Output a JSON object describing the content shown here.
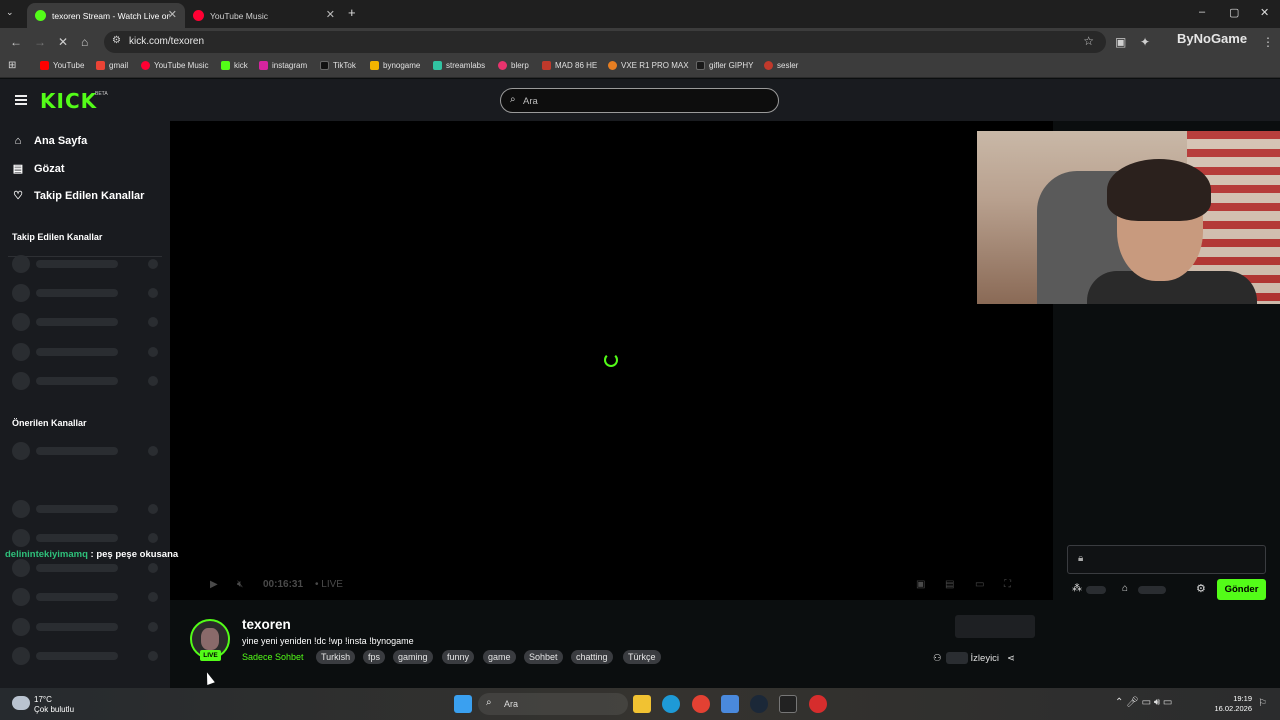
{
  "browser": {
    "tabs": [
      {
        "label": "texoren Stream - Watch Live on Kick",
        "active": true,
        "favicon_color": "#53fc18"
      },
      {
        "label": "YouTube Music",
        "active": false,
        "favicon_color": "#ff0033"
      }
    ],
    "new_tab": "+",
    "window_controls": {
      "minimize": "–",
      "maximize": "▢",
      "close": "✕"
    },
    "url": "kick.com/texoren",
    "profile_overlay": "ByNoGame",
    "bookmarks": [
      {
        "label": "YouTube",
        "color": "#ff0000"
      },
      {
        "label": "gmail",
        "color": "#ea4335"
      },
      {
        "label": "YouTube Music",
        "color": "#ff0033"
      },
      {
        "label": "kick",
        "color": "#53fc18"
      },
      {
        "label": "instagram",
        "color": "#d6249f"
      },
      {
        "label": "TikTok",
        "color": "#111111"
      },
      {
        "label": "bynogame",
        "color": "#f4b400"
      },
      {
        "label": "streamlabs",
        "color": "#31c3a2"
      },
      {
        "label": "blerp",
        "color": "#e8336d"
      },
      {
        "label": "MAD 86 HE",
        "color": "#c0392b"
      },
      {
        "label": "VXE R1 PRO MAX",
        "color": "#e67e22"
      },
      {
        "label": "gifler GIPHY",
        "color": "#1a1a1a"
      },
      {
        "label": "sesler",
        "color": "#c0392b"
      }
    ]
  },
  "kick": {
    "logo": "KICK",
    "beta": "BETA",
    "search_placeholder": "Ara",
    "nav": [
      {
        "label": "Ana Sayfa",
        "icon": "home-icon"
      },
      {
        "label": "Gözat",
        "icon": "browse-icon"
      },
      {
        "label": "Takip Edilen Kanallar",
        "icon": "heart-icon"
      }
    ],
    "followed_heading": "Takip Edilen Kanallar",
    "suggested_heading": "Önerilen Kanallar",
    "chat_overlay": {
      "user": "delinintekiyimamq",
      "text": " : peş peşe okusana"
    },
    "player": {
      "time": "00:16:31",
      "live_label": "LIVE"
    },
    "streamer": {
      "name": "texoren",
      "title": "yine yeni yeniden  !dc !wp !insta !bynogame",
      "category": "Sadece Sohbet",
      "tags": [
        "Turkish",
        "fps",
        "gaming",
        "funny",
        "game",
        "Sohbet",
        "chatting",
        "Türkçe"
      ],
      "live_badge": "LIVE",
      "viewers_label": "İzleyici"
    },
    "chat": {
      "send_label": "Gönder"
    }
  },
  "taskbar": {
    "temperature": "17°C",
    "weather": "Çok bulutlu",
    "search": "Ara",
    "time": "19:19",
    "date": "16.02.2026"
  }
}
